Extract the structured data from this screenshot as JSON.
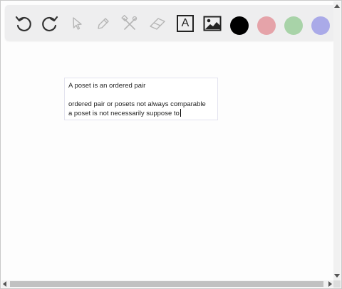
{
  "toolbar": {
    "tools": [
      {
        "name": "undo-icon",
        "enabled": true
      },
      {
        "name": "redo-icon",
        "enabled": true
      },
      {
        "name": "select-pointer-icon",
        "enabled": false
      },
      {
        "name": "pen-icon",
        "enabled": false
      },
      {
        "name": "tools-icon",
        "enabled": false
      },
      {
        "name": "eraser-icon",
        "enabled": false
      },
      {
        "name": "text-icon",
        "enabled": true
      },
      {
        "name": "image-icon",
        "enabled": true
      }
    ],
    "text_tool_glyph": "A",
    "colors": [
      "#000000",
      "#e5a3a9",
      "#a8d3a8",
      "#aaaae8"
    ]
  },
  "canvas": {
    "textbox": {
      "line1": "A poset is an ordered pair",
      "line2": "ordered pair or posets not always comparable",
      "line3": "a poset is not necessarily suppose to"
    }
  }
}
